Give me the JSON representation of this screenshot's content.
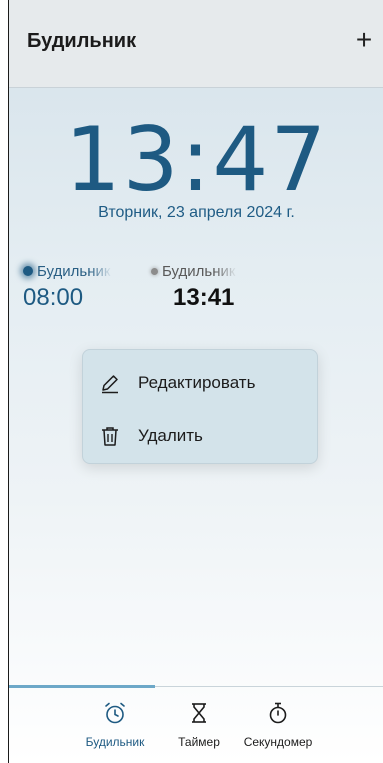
{
  "header": {
    "title": "Будильник",
    "add_label": "+",
    "add_icon": "plus-icon"
  },
  "clock": {
    "time": "13:47",
    "date": "Вторник, 23 апреля 2024 г."
  },
  "alarms": [
    {
      "name": "Будильник",
      "time": "08:00",
      "active": true
    },
    {
      "name": "Будильник",
      "time": "13:41",
      "active": false
    }
  ],
  "context_menu": {
    "items": [
      {
        "label": "Редактировать",
        "icon": "pencil-icon"
      },
      {
        "label": "Удалить",
        "icon": "trash-icon"
      }
    ]
  },
  "tabs": [
    {
      "label": "Будильник",
      "icon": "alarm-clock-icon",
      "selected": true
    },
    {
      "label": "Таймер",
      "icon": "hourglass-icon",
      "selected": false
    },
    {
      "label": "Секундомер",
      "icon": "stopwatch-icon",
      "selected": false
    }
  ],
  "colors": {
    "accent": "#1e5a82",
    "menu_bg": "#d3e3ea",
    "header_bg": "#e6eaec"
  }
}
